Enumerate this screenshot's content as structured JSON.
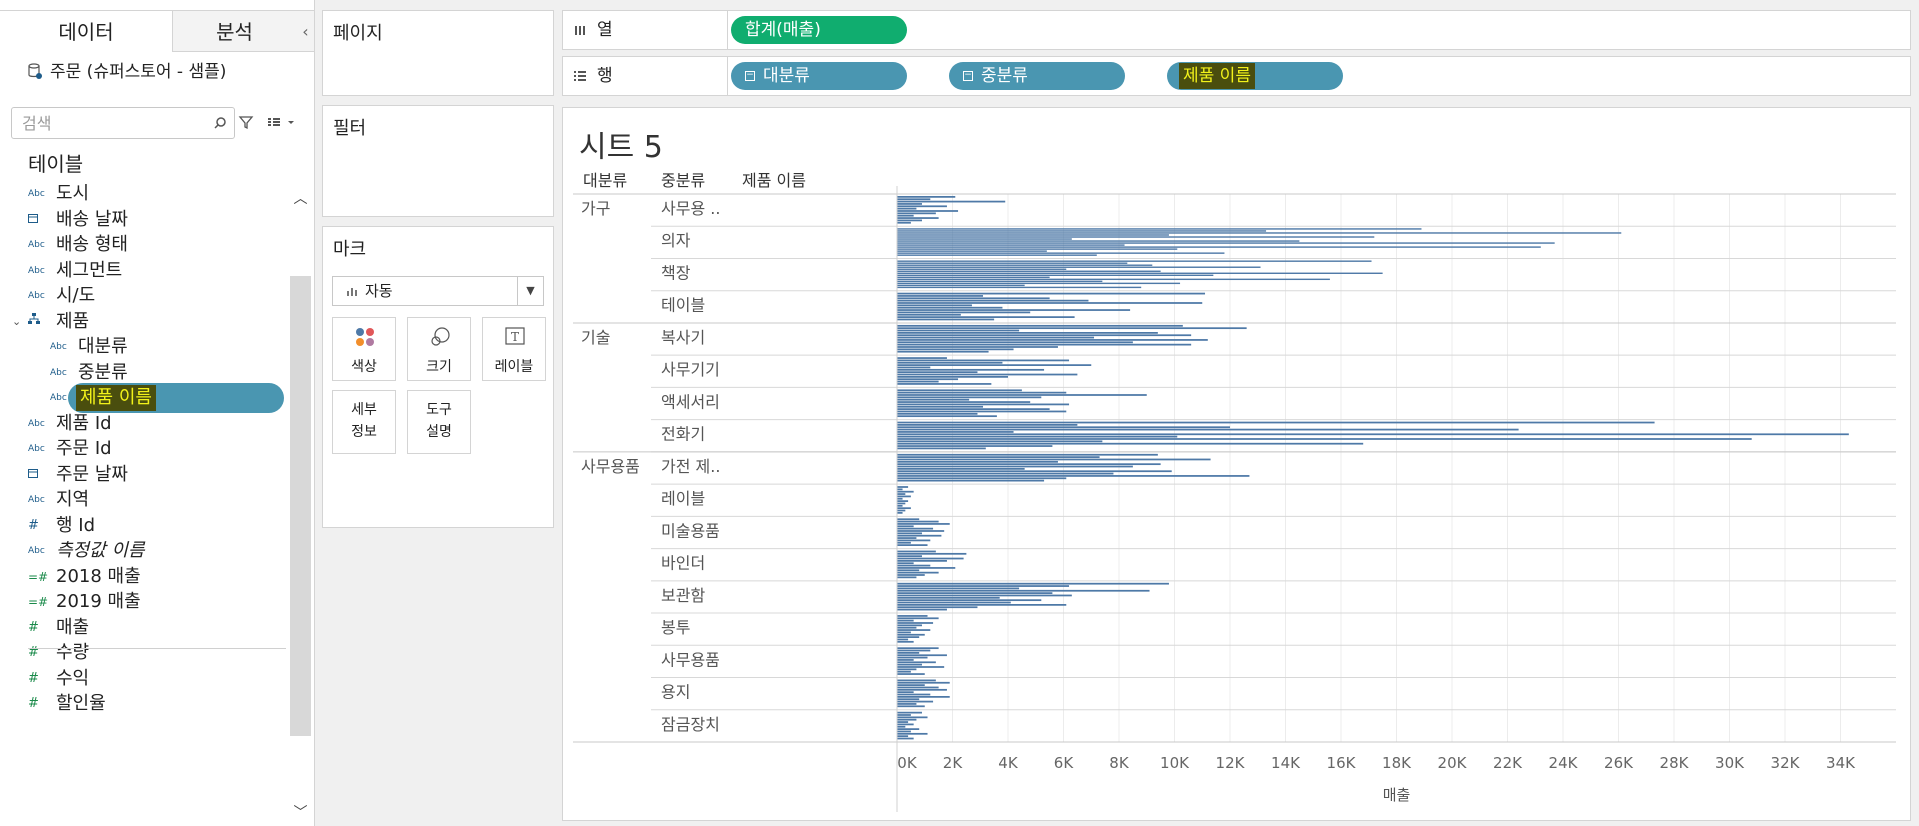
{
  "data_pane": {
    "tab_data": "데이터",
    "tab_analysis": "분석",
    "collapse_glyph": "‹",
    "datasource": "주문 (슈퍼스토어 - 샘플)",
    "search_placeholder": "검색",
    "tables_heading": "테이블",
    "fields": [
      {
        "label": "도시",
        "icon": "Abc",
        "kind": "dimension",
        "indent": 0
      },
      {
        "label": "배송 날짜",
        "icon": "calendar",
        "kind": "dimension",
        "indent": 0
      },
      {
        "label": "배송 형태",
        "icon": "Abc",
        "kind": "dimension",
        "indent": 0
      },
      {
        "label": "세그먼트",
        "icon": "Abc",
        "kind": "dimension",
        "indent": 0
      },
      {
        "label": "시/도",
        "icon": "Abc",
        "kind": "dimension",
        "indent": 0
      },
      {
        "label": "제품",
        "icon": "hierarchy",
        "kind": "hierarchy",
        "indent": 0
      },
      {
        "label": "대분류",
        "icon": "Abc",
        "kind": "dimension",
        "indent": 1
      },
      {
        "label": "중분류",
        "icon": "Abc",
        "kind": "dimension",
        "indent": 1
      },
      {
        "label": "제품 이름",
        "icon": "Abc",
        "kind": "dimension",
        "indent": 1,
        "selected": true
      },
      {
        "label": "제품 Id",
        "icon": "Abc",
        "kind": "dimension",
        "indent": 0
      },
      {
        "label": "주문 Id",
        "icon": "Abc",
        "kind": "dimension",
        "indent": 0
      },
      {
        "label": "주문 날짜",
        "icon": "calendar",
        "kind": "dimension",
        "indent": 0
      },
      {
        "label": "지역",
        "icon": "Abc",
        "kind": "dimension",
        "indent": 0
      },
      {
        "label": "행 Id",
        "icon": "#",
        "kind": "dimension",
        "indent": 0
      },
      {
        "label": "측정값 이름",
        "icon": "Abc",
        "kind": "dimension",
        "indent": 0,
        "italic": true
      },
      {
        "label": "2018 매출",
        "icon": "calc#",
        "kind": "measure",
        "indent": 0
      },
      {
        "label": "2019 매출",
        "icon": "calc#",
        "kind": "measure",
        "indent": 0
      },
      {
        "label": "매출",
        "icon": "#",
        "kind": "measure",
        "indent": 0
      },
      {
        "label": "수량",
        "icon": "#",
        "kind": "measure",
        "indent": 0
      },
      {
        "label": "수익",
        "icon": "#",
        "kind": "measure",
        "indent": 0
      },
      {
        "label": "할인율",
        "icon": "#",
        "kind": "measure",
        "indent": 0
      }
    ]
  },
  "cards": {
    "pages": "페이지",
    "filters": "필터",
    "marks": "마크",
    "mark_type": "자동",
    "mark_buttons": {
      "color": "색상",
      "size": "크기",
      "label": "레이블",
      "detail": "세부\n정보",
      "tooltip": "도구\n설명"
    }
  },
  "shelves": {
    "columns_label": "열",
    "rows_label": "행",
    "columns_pills": [
      {
        "text": "합계(매출)",
        "style": "green"
      }
    ],
    "rows_pills": [
      {
        "text": "대분류",
        "style": "blue",
        "collapse": true
      },
      {
        "text": "중분류",
        "style": "blue",
        "collapse": true
      },
      {
        "text": "제품 이름",
        "style": "blue",
        "highlight": true
      }
    ]
  },
  "viz": {
    "sheet_title": "시트 5",
    "header_labels": [
      "대분류",
      "중분류",
      "제품 이름"
    ]
  },
  "colors": {
    "bar": "#4e79a7",
    "green_pill": "#10ad6f",
    "blue_pill": "#4a96b1",
    "highlight_bg": "#4a4e0e",
    "highlight_text": "#f2f21a"
  },
  "chart_data": {
    "type": "bar",
    "orientation": "horizontal",
    "xlabel": "매출",
    "xlim": [
      0,
      36000
    ],
    "x_ticks": [
      "0K",
      "2K",
      "4K",
      "6K",
      "8K",
      "10K",
      "12K",
      "14K",
      "16K",
      "18K",
      "20K",
      "22K",
      "24K",
      "26K",
      "28K",
      "30K",
      "32K",
      "34K"
    ],
    "tick_values": [
      0,
      2000,
      4000,
      6000,
      8000,
      10000,
      12000,
      14000,
      16000,
      18000,
      20000,
      22000,
      24000,
      26000,
      28000,
      30000,
      32000,
      34000
    ],
    "grid": true,
    "groups": [
      {
        "category": "가구",
        "sub": [
          {
            "name": "사무용 ..",
            "values": [
              2100,
              1200,
              3900,
              900,
              1800,
              700,
              2200,
              1400,
              600,
              1500,
              900,
              500
            ]
          },
          {
            "name": "의자",
            "values": [
              18900,
              13300,
              26100,
              9800,
              17200,
              6300,
              14500,
              23700,
              8200,
              23200,
              10100,
              5400,
              11800,
              7200
            ]
          },
          {
            "name": "책장",
            "values": [
              17100,
              8300,
              9200,
              13100,
              6100,
              9500,
              17500,
              11400,
              5500,
              15600,
              7400,
              10200,
              4600,
              8800
            ]
          },
          {
            "name": "테이블",
            "values": [
              11100,
              3100,
              5500,
              6900,
              11000,
              2700,
              3800,
              8400,
              4800,
              2300,
              6400,
              3500
            ]
          }
        ]
      },
      {
        "category": "기술",
        "sub": [
          {
            "name": "복사기",
            "values": [
              10300,
              12600,
              4400,
              9400,
              10600,
              7100,
              11200,
              8500,
              10600,
              5800,
              4200,
              3300
            ]
          },
          {
            "name": "사무기기",
            "values": [
              1800,
              6200,
              3800,
              7000,
              1200,
              5300,
              2900,
              6500,
              4000,
              2200,
              1500,
              3400
            ]
          },
          {
            "name": "액세서리",
            "values": [
              4500,
              6100,
              9000,
              5200,
              2600,
              4800,
              6200,
              3100,
              5500,
              6100,
              2900,
              3600
            ]
          },
          {
            "name": "전화기",
            "values": [
              27300,
              6500,
              12000,
              22400,
              4200,
              34300,
              10100,
              30800,
              7400,
              16800,
              5600,
              3200
            ]
          }
        ]
      },
      {
        "category": "사무용품",
        "sub": [
          {
            "name": "가전 제..",
            "values": [
              9400,
              7300,
              11300,
              5800,
              9500,
              8500,
              4600,
              9900,
              7800,
              12700,
              6100,
              5300
            ]
          },
          {
            "name": "레이블",
            "values": [
              400,
              200,
              600,
              300,
              500,
              200,
              400,
              300,
              200,
              500,
              300,
              200
            ]
          },
          {
            "name": "미술용품",
            "values": [
              800,
              1500,
              1900,
              600,
              1300,
              1700,
              900,
              1600,
              700,
              1200,
              500,
              1100
            ]
          },
          {
            "name": "바인더",
            "values": [
              1400,
              2500,
              900,
              2400,
              1800,
              600,
              1200,
              2100,
              800,
              1500,
              1000,
              700
            ]
          },
          {
            "name": "보관함",
            "values": [
              9800,
              6200,
              4400,
              9100,
              5600,
              6300,
              3700,
              5200,
              4100,
              6100,
              2900,
              1800
            ]
          },
          {
            "name": "봉투",
            "values": [
              1100,
              1500,
              600,
              1300,
              900,
              700,
              1200,
              500,
              1000,
              800,
              400,
              600
            ]
          },
          {
            "name": "사무용품",
            "values": [
              1500,
              1200,
              800,
              1800,
              1100,
              600,
              1400,
              900,
              1700,
              700,
              500,
              1000
            ]
          },
          {
            "name": "용지",
            "values": [
              1400,
              1900,
              1000,
              1500,
              1800,
              600,
              1200,
              1900,
              800,
              1300,
              700,
              1000
            ]
          },
          {
            "name": "잠금장치",
            "values": [
              900,
              500,
              1100,
              700,
              400,
              600,
              300,
              800,
              500,
              1100,
              400,
              600
            ]
          }
        ]
      }
    ]
  }
}
